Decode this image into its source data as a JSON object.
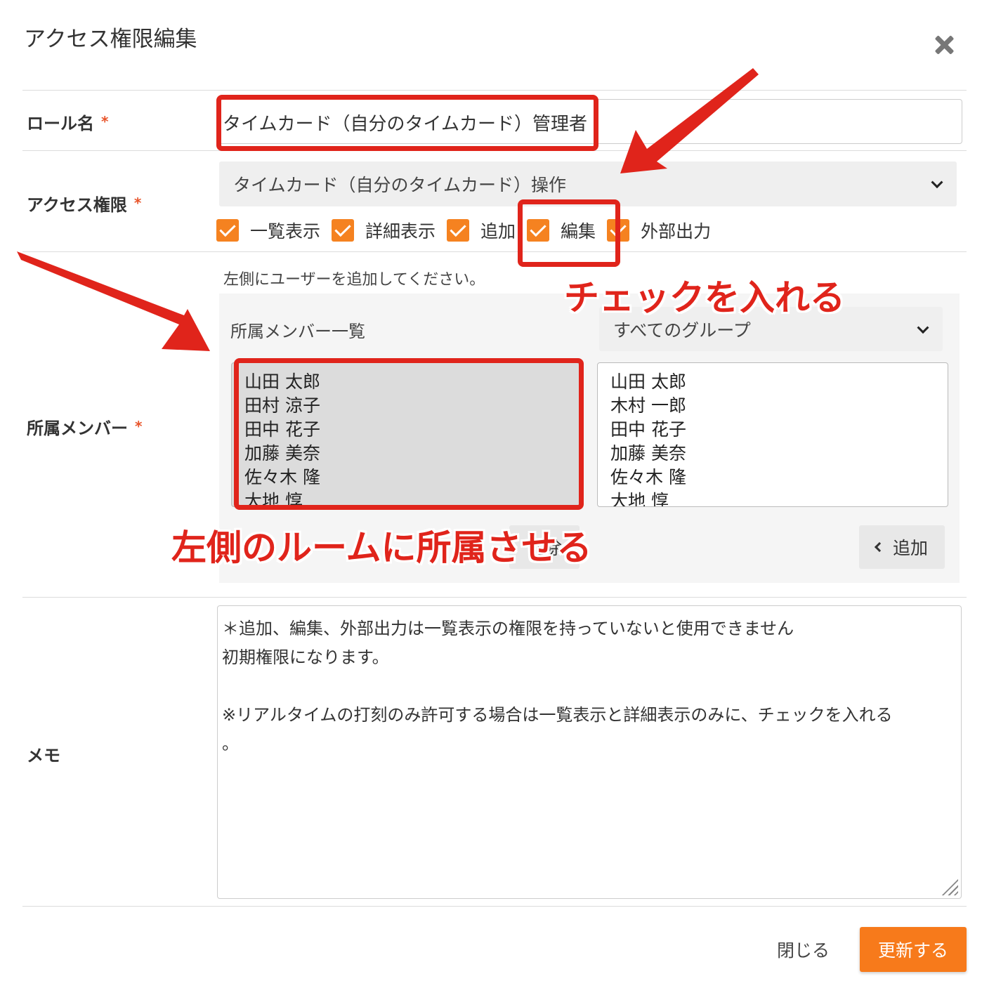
{
  "dialog": {
    "title": "アクセス権限編集"
  },
  "role": {
    "label": "ロール名",
    "required_mark": "*",
    "value": "タイムカード（自分のタイムカード）管理者"
  },
  "access": {
    "label": "アクセス権限",
    "required_mark": "*",
    "selected": "タイムカード（自分のタイムカード）操作",
    "permissions": [
      {
        "label": "一覧表示",
        "checked": true
      },
      {
        "label": "詳細表示",
        "checked": true
      },
      {
        "label": "追加",
        "checked": true
      },
      {
        "label": "編集",
        "checked": true
      },
      {
        "label": "外部出力",
        "checked": true
      }
    ]
  },
  "members": {
    "label": "所属メンバー",
    "required_mark": "*",
    "hint": "左側にユーザーを追加してください。",
    "list_heading": "所属メンバー一覧",
    "group_selected": "すべてのグループ",
    "assigned": [
      "山田 太郎",
      "田村 涼子",
      "田中 花子",
      "加藤 美奈",
      "佐々木 隆",
      "大地 惇"
    ],
    "available": [
      "山田 太郎",
      "木村 一郎",
      "田中 花子",
      "加藤 美奈",
      "佐々木 隆",
      "大地 惇"
    ],
    "remove_button": "削除",
    "add_button": "追加"
  },
  "memo": {
    "label": "メモ",
    "lines": [
      "＊追加、編集、外部出力は一覧表示の権限を持っていないと使用できません",
      "初期権限になります。",
      "",
      "※リアルタイムの打刻のみ許可する場合は一覧表示と詳細表示のみに、チェックを入れる",
      "。"
    ]
  },
  "footer": {
    "close_label": "閉じる",
    "update_label": "更新する"
  },
  "annotations": {
    "check_text": "チェックを入れる",
    "member_text": "左側のルームに所属させる",
    "color": "#e0241b"
  },
  "colors": {
    "accent": "#f77a1b",
    "checkbox": "#f58220"
  }
}
